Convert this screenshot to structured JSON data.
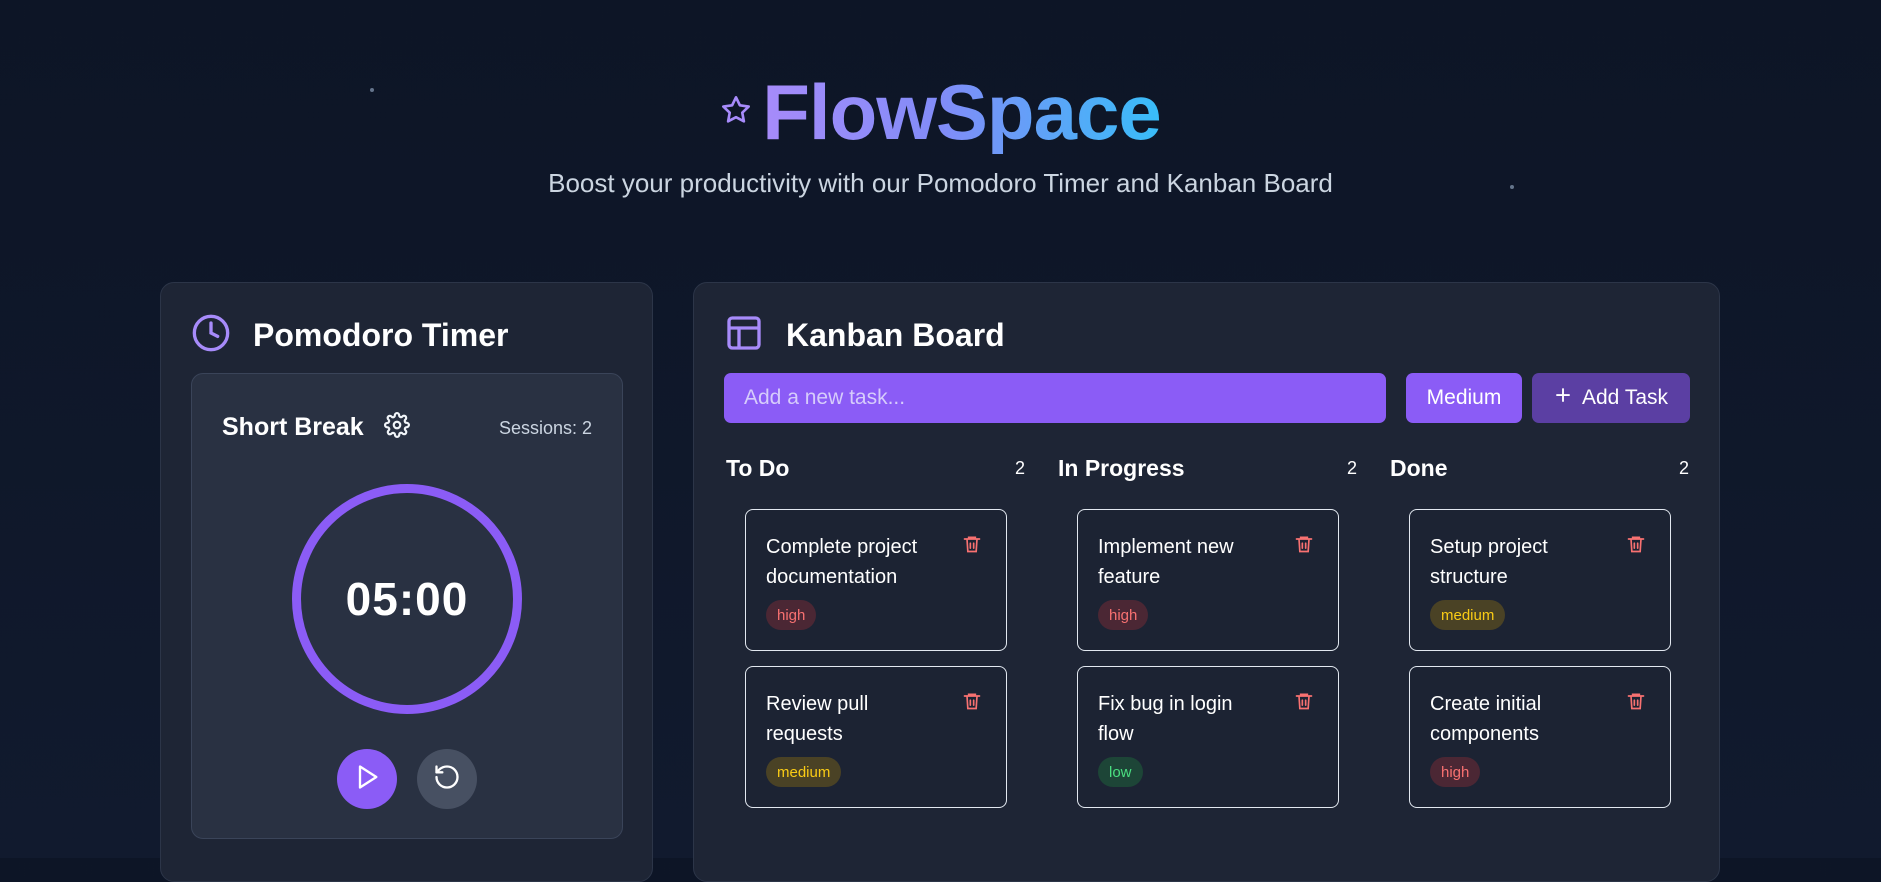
{
  "header": {
    "title": "FlowSpace",
    "subtitle": "Boost your productivity with our Pomodoro Timer and Kanban Board",
    "logo_icon": "star-icon"
  },
  "pomodoro": {
    "title": "Pomodoro Timer",
    "mode": "Short Break",
    "sessions": "Sessions: 2",
    "time": "05:00",
    "progress": 1.0
  },
  "kanban": {
    "title": "Kanban Board",
    "input_placeholder": "Add a new task...",
    "priority_label": "Medium",
    "add_label": "Add Task",
    "columns": [
      {
        "title": "To Do",
        "count": "2",
        "tasks": [
          {
            "title": "Complete project documentation",
            "priority": "high"
          },
          {
            "title": "Review pull requests",
            "priority": "medium"
          }
        ]
      },
      {
        "title": "In Progress",
        "count": "2",
        "tasks": [
          {
            "title": "Implement new feature",
            "priority": "high"
          },
          {
            "title": "Fix bug in login flow",
            "priority": "low"
          }
        ]
      },
      {
        "title": "Done",
        "count": "2",
        "tasks": [
          {
            "title": "Setup project structure",
            "priority": "medium"
          },
          {
            "title": "Create initial components",
            "priority": "high"
          }
        ]
      }
    ]
  },
  "colors": {
    "accent": "#8b5cf6",
    "background": "#0f172a",
    "card": "#1e2535",
    "high": "#f87171",
    "medium": "#facc15",
    "low": "#4ade80"
  }
}
